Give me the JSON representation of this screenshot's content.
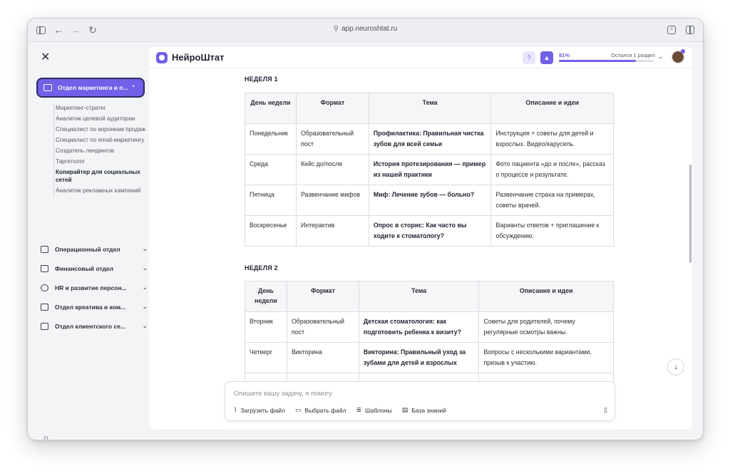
{
  "browser": {
    "url": "app.neuroshtat.ru",
    "icons": [
      "sidebar-toggle-icon",
      "back-arrow-icon",
      "forward-arrow-icon",
      "reload-icon",
      "lock-icon",
      "reader-icon",
      "split-view-icon"
    ]
  },
  "app": {
    "name": "НейроШтат",
    "progress_percent": "81%",
    "progress_value": 0.81,
    "progress_note": "Остался 1 раздел",
    "accent": "#7160e8"
  },
  "sidebar": {
    "active_department": "Отдел маркетинга и п...",
    "sub_items": [
      {
        "label": "Маркетинг-стратег",
        "active": false
      },
      {
        "label": "Аналитик целевой аудитории",
        "active": false
      },
      {
        "label": "Специалист по воронкам продаж",
        "active": false
      },
      {
        "label": "Специалист по email-маркетингу",
        "active": false
      },
      {
        "label": "Создатель лендингов",
        "active": false
      },
      {
        "label": "Таргетолог",
        "active": false
      },
      {
        "label": "Копирайтер для социальных сетей",
        "active": true
      },
      {
        "label": "Аналитик рекламных кампаний",
        "active": false
      }
    ],
    "departments": [
      {
        "label": "Операционный отдел",
        "icon": "grid-icon"
      },
      {
        "label": "Финансовый отдел",
        "icon": "wallet-icon"
      },
      {
        "label": "HR и развитие персон...",
        "icon": "users-icon"
      },
      {
        "label": "Отдел креатива и ком...",
        "icon": "chat-icon"
      },
      {
        "label": "Отдел клиентского се...",
        "icon": "id-card-icon"
      }
    ]
  },
  "weeks": [
    {
      "title": "НЕДЕЛЯ 1",
      "headers": [
        "День недели",
        "Формат",
        "Тема",
        "Описание и идеи"
      ],
      "rows": [
        [
          "Понедельник",
          "Образовательный пост",
          "Профилактика: Правильная чистка зубов для всей семьи",
          "Инструкция + советы для детей и взрослых. Видео/карусель."
        ],
        [
          "Среда",
          "Кейс до/после",
          "История протезирования — пример из нашей практики",
          "Фото пациента «до и после», рассказ о процессе и результате."
        ],
        [
          "Пятница",
          "Развенчание мифов",
          "Миф: Лечение зубов — больно?",
          "Развенчание страха на примерах, советы врачей."
        ],
        [
          "Воскресенье",
          "Интерактив",
          "Опрос в сторис: Как часто вы ходите к стоматологу?",
          "Варианты ответов + приглашение к обсуждению."
        ]
      ]
    },
    {
      "title": "НЕДЕЛЯ 2",
      "headers": [
        "День недели",
        "Формат",
        "Тема",
        "Описание и идеи"
      ],
      "rows": [
        [
          "Вторник",
          "Образовательный пост",
          "Детская стоматология: как подготовить ребенка к визиту?",
          "Советы для родителей, почему регулярные осмотры важны."
        ],
        [
          "Четверг",
          "Викторина",
          "Викторина: Правильный уход за зубами для детей и взрослых",
          "Вопросы с несколькими вариантами, призыв к участию."
        ],
        [
          "",
          "",
          "",
          ""
        ]
      ]
    }
  ],
  "composer": {
    "placeholder": "Опишите вашу задачу, я помогу",
    "actions": [
      {
        "label": "Загрузить файл",
        "icon": "paperclip-icon"
      },
      {
        "label": "Выбрать файл",
        "icon": "folder-icon"
      },
      {
        "label": "Шаблоны",
        "icon": "templates-icon"
      },
      {
        "label": "База знаний",
        "icon": "book-icon"
      }
    ]
  }
}
